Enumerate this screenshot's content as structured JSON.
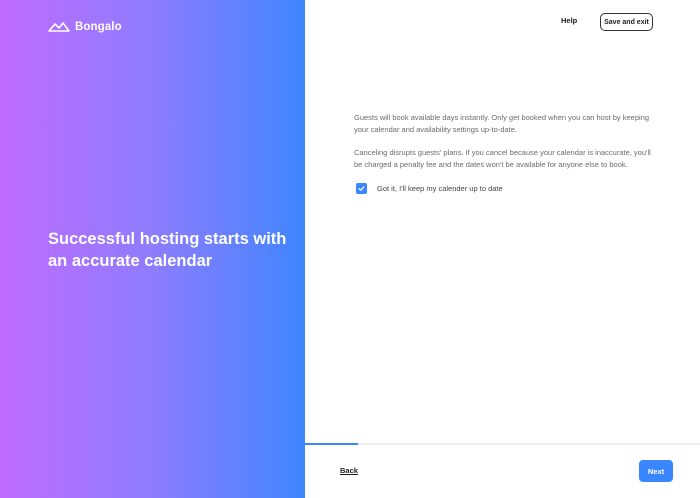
{
  "brand": {
    "name": "Bongalo",
    "icon": "roof-logo-icon"
  },
  "left_panel": {
    "headline": "Successful hosting starts with an accurate calendar",
    "gradient_start": "#c06bff",
    "gradient_end": "#3f86ff"
  },
  "header": {
    "help_label": "Help",
    "save_exit_label": "Save and exit"
  },
  "main": {
    "paragraph_1": "Guests will book available days instantly. Only get booked when you can host by keeping your calendar and availability settings up-to-date.",
    "paragraph_2": "Canceling disrupts guests' plans. If you cancel because your calendar is inaccurate, you'll be charged a penalty fee and the dates won't be available for anyone else to book.",
    "checkbox": {
      "label": "Got it, I'll keep my calender up to date",
      "checked": true,
      "icon": "checkmark-icon"
    }
  },
  "footer": {
    "progress": 0.135,
    "back_label": "Back",
    "next_label": "Next"
  },
  "colors": {
    "accent": "#3a86ff",
    "text": "#222222",
    "muted": "#6b6b6b"
  }
}
